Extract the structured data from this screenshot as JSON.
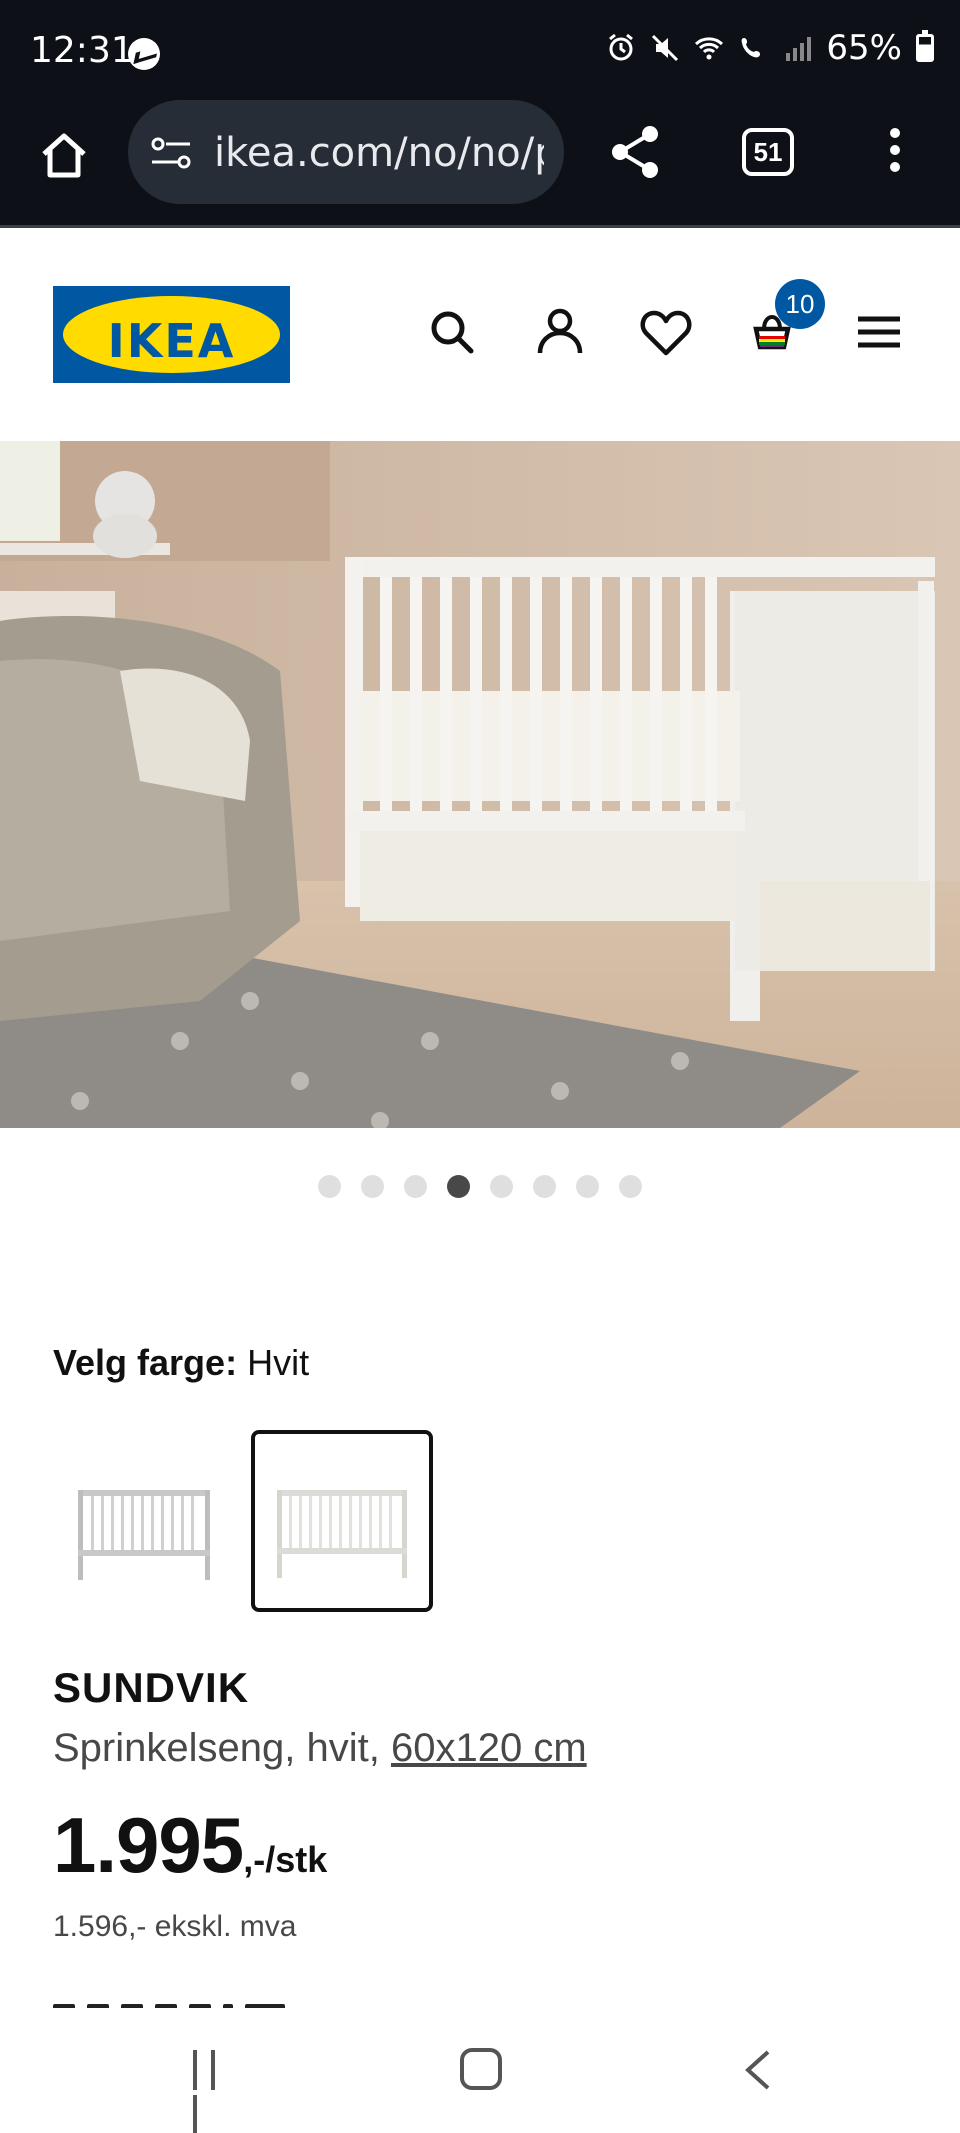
{
  "status_bar": {
    "time": "12:31",
    "battery_percent": "65%",
    "icons": [
      "messenger-icon",
      "alarm-icon",
      "mute-icon",
      "wifi-icon",
      "wifi-calling-icon",
      "signal-icon",
      "battery-icon"
    ]
  },
  "browser": {
    "url": "ikea.com/no/no/p...",
    "tab_count": "51"
  },
  "header": {
    "logo_text": "IKEA",
    "cart_count": "10",
    "icons": [
      "search-icon",
      "account-icon",
      "heart-icon",
      "cart-icon",
      "menu-icon"
    ]
  },
  "carousel": {
    "total": 8,
    "active_index": 3
  },
  "product": {
    "color_label": "Velg farge:",
    "color_value": "Hvit",
    "name": "SUNDVIK",
    "description": "Sprinkelseng, hvit,",
    "size": "60x120 cm",
    "price": "1.995",
    "price_suffix": ",-/stk",
    "price_ex_vat": "1.596,- ekskl. mva"
  },
  "colors": {
    "brand_blue": "#0058a3",
    "brand_yellow": "#ffdb00",
    "status_bg": "#0d1117"
  }
}
